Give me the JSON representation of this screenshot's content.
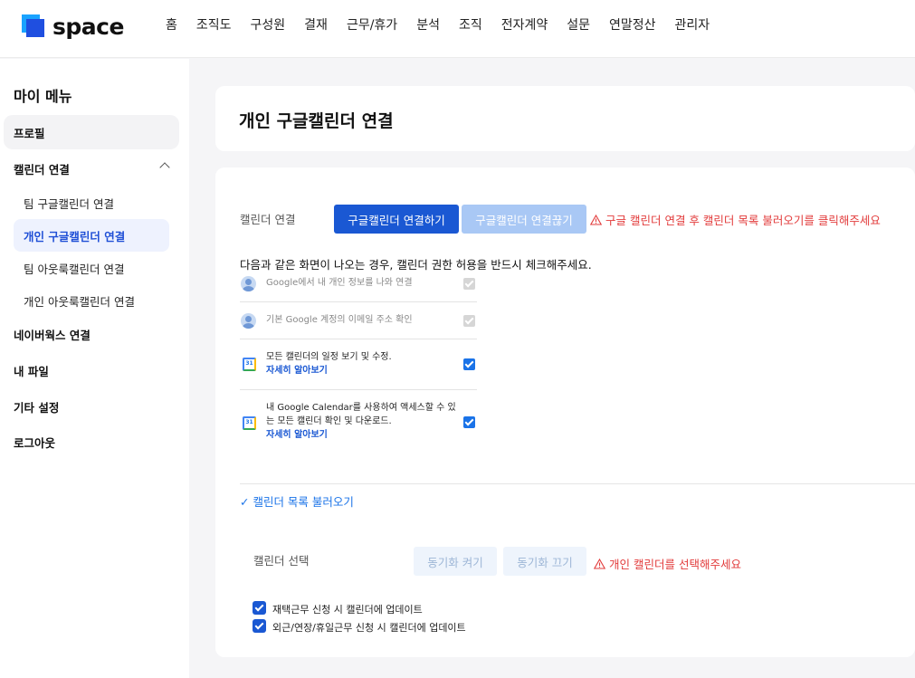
{
  "app": {
    "logo_text": "space"
  },
  "gnb": [
    "홈",
    "조직도",
    "구성원",
    "결재",
    "근무/휴가",
    "분석",
    "조직",
    "전자계약",
    "설문",
    "연말정산",
    "관리자"
  ],
  "sidebar": {
    "title": "마이 메뉴",
    "profile": "프로필",
    "calendar_group": "캘린더 연결",
    "calendar_items": [
      "팀 구글캘린더 연결",
      "개인 구글캘린더 연결",
      "팀 아웃룩캘린더 연결",
      "개인 아웃룩캘린더 연결"
    ],
    "naverworks": "네이버웍스 연결",
    "my_files": "내 파일",
    "other_settings": "기타 설정",
    "logout": "로그아웃"
  },
  "page": {
    "title": "개인 구글캘린더 연결"
  },
  "connect": {
    "label": "캘린더 연결",
    "connect_button": "구글캘린더 연결하기",
    "disconnect_button": "구글캘린더 연결끊기",
    "warning": "구글 캘린더 연결 후 캘린더 목록 불러오기를 클릭해주세요",
    "notice": "다음과 같은 화면이 나오는 경우, 캘린더 권한 허용을 반드시 체크해주세요."
  },
  "permissions": [
    {
      "text": "Google에서 내 개인 정보를 나와 연결"
    },
    {
      "text": "기본 Google 계정의 이메일 주소 확인"
    },
    {
      "text": "모든 캘린더의 일정 보기 및 수정.",
      "link": "자세히 알아보기"
    },
    {
      "line1": "내 Google Calendar를 사용하여 액세스할 수 있",
      "line2": "는 모든 캘린더 확인 및 다운로드.",
      "link": "자세히 알아보기"
    }
  ],
  "gcal_icon_text": "31",
  "load_calendars": "✓ 캘린더 목록 불러오기",
  "select": {
    "label": "캘린더 선택",
    "sync_on": "동기화 켜기",
    "sync_off": "동기화 끄기",
    "warning": "개인 캘린더를 선택해주세요"
  },
  "options": [
    {
      "label": "재택근무 신청 시 캘린더에 업데이트",
      "checked": true
    },
    {
      "label": "외근/연장/휴일근무 신청 시 캘린더에 업데이트",
      "checked": true
    }
  ],
  "colors": {
    "primary": "#1a58d3",
    "warning": "#e23b3b",
    "link": "#1a73e8"
  }
}
